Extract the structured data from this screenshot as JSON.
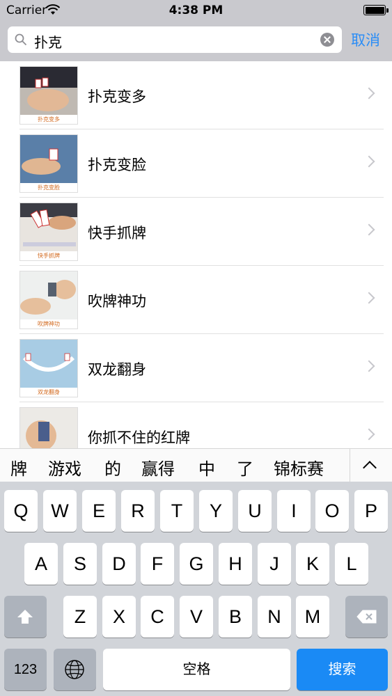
{
  "status_bar": {
    "carrier": "Carrier",
    "time": "4:38 PM"
  },
  "search": {
    "query": "扑克",
    "cancel_label": "取消"
  },
  "results": [
    {
      "title": "扑克变多",
      "caption": "扑克变多"
    },
    {
      "title": "扑克变脸",
      "caption": "扑克变脸"
    },
    {
      "title": "快手抓牌",
      "caption": "快手抓牌"
    },
    {
      "title": "吹牌神功",
      "caption": "吹牌神功"
    },
    {
      "title": "双龙翻身",
      "caption": "双龙翻身"
    },
    {
      "title": "你抓不住的红牌",
      "caption": ""
    }
  ],
  "candidates": [
    "牌",
    "游戏",
    "的",
    "赢得",
    "中",
    "了",
    "锦标赛"
  ],
  "keyboard": {
    "row1": [
      "Q",
      "W",
      "E",
      "R",
      "T",
      "Y",
      "U",
      "I",
      "O",
      "P"
    ],
    "row2": [
      "A",
      "S",
      "D",
      "F",
      "G",
      "H",
      "J",
      "K",
      "L"
    ],
    "row3": [
      "Z",
      "X",
      "C",
      "V",
      "B",
      "N",
      "M"
    ],
    "numbers_label": "123",
    "space_label": "空格",
    "search_label": "搜索"
  },
  "colors": {
    "accent": "#2b8df6",
    "search_key": "#1a8af5",
    "keyboard_bg": "#d1d4d9"
  },
  "icons": [
    "wifi-icon",
    "battery-icon",
    "search-icon",
    "clear-icon",
    "chevron-right-icon",
    "chevron-up-icon",
    "shift-icon",
    "delete-icon",
    "globe-icon"
  ]
}
